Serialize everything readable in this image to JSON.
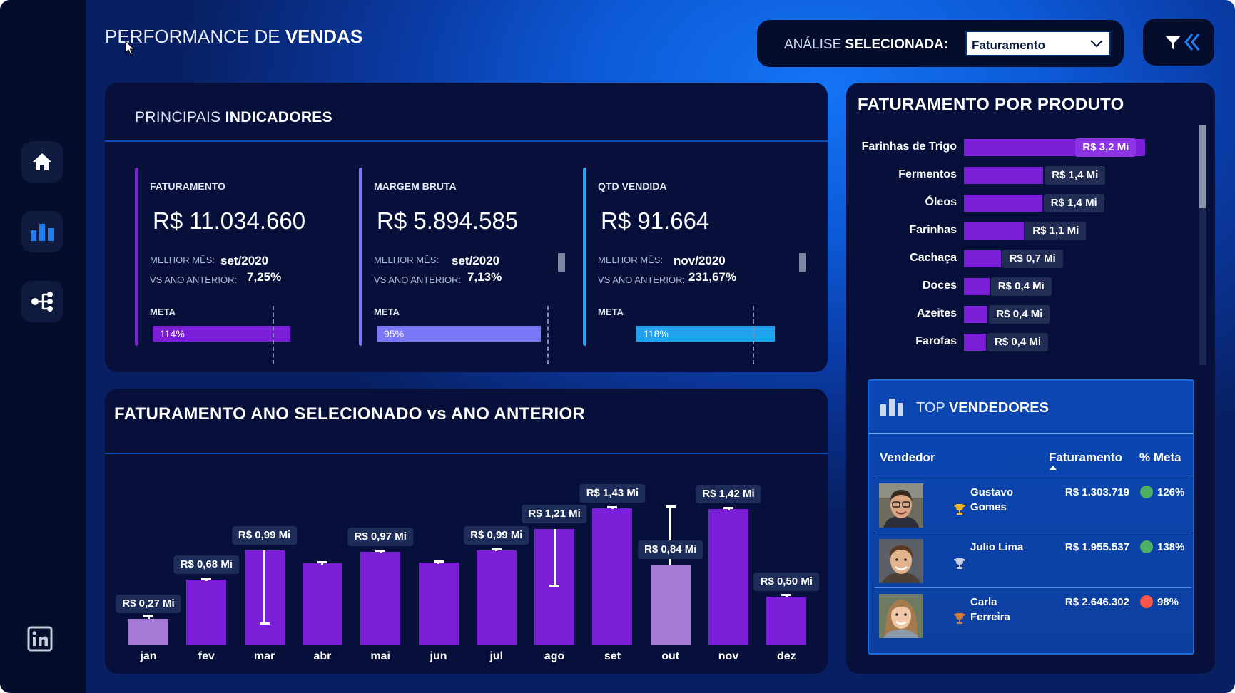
{
  "header": {
    "title_light": "PERFORMANCE DE ",
    "title_bold": "VENDAS",
    "analysis_label_light": "ANÁLISE ",
    "analysis_label_bold": "SELECIONADA:",
    "analysis_selected": "Faturamento"
  },
  "sidebar": {
    "items": [
      {
        "icon": "home-icon"
      },
      {
        "icon": "bar-chart-icon"
      },
      {
        "icon": "decomposition-tree-icon"
      }
    ],
    "footer_icon": "linkedin-icon"
  },
  "indicators": {
    "title_light": "PRINCIPAIS ",
    "title_bold": "INDICADORES",
    "best_month_label": "MELHOR MÊS:",
    "vs_prev_label": "VS ANO ANTERIOR:",
    "meta_label": "META",
    "kpis": [
      {
        "label": "FATURAMENTO",
        "value": "R$ 11.034.660",
        "best_month": "set/2020",
        "vs_prev": "7,25%",
        "meta": 114,
        "meta_text": "114%",
        "color": "#7a1ed8"
      },
      {
        "label": "MARGEM BRUTA",
        "value": "R$ 5.894.585",
        "best_month": "set/2020",
        "vs_prev": "7,13%",
        "meta": 95,
        "meta_text": "95%",
        "color": "#7b78f7"
      },
      {
        "label": "QTD VENDIDA",
        "value": "R$ 91.664",
        "best_month": "nov/2020",
        "vs_prev": "231,67%",
        "meta": 118,
        "meta_text": "118%",
        "color": "#1fa3ef"
      }
    ]
  },
  "monthly": {
    "title": "FATURAMENTO ANO SELECIONADO vs ANO ANTERIOR"
  },
  "chart_data": {
    "type": "bar",
    "categories": [
      "jan",
      "fev",
      "mar",
      "abr",
      "mai",
      "jun",
      "jul",
      "ago",
      "set",
      "out",
      "nov",
      "dez"
    ],
    "values": [
      0.27,
      0.68,
      0.99,
      0.85,
      0.97,
      0.86,
      0.99,
      1.21,
      1.43,
      0.84,
      1.42,
      0.5
    ],
    "previous_year": [
      0.3,
      0.69,
      0.22,
      0.86,
      0.98,
      0.87,
      1.0,
      0.62,
      1.44,
      1.45,
      1.43,
      0.52
    ],
    "labels": [
      "R$ 0,27 Mi",
      "R$ 0,68 Mi",
      "R$ 0,99 Mi",
      "",
      "R$ 0,97 Mi",
      "",
      "R$ 0,99 Mi",
      "R$ 1,21 Mi",
      "R$ 1,43 Mi",
      "R$ 0,84 Mi",
      "R$ 1,42 Mi",
      "R$ 0,50 Mi"
    ],
    "below_previous": [
      true,
      false,
      false,
      false,
      false,
      false,
      false,
      false,
      false,
      true,
      false,
      false
    ],
    "colors": {
      "up": "#7a1ed8",
      "down": "#a779d6",
      "marker": "#ffffff"
    },
    "ylim": [
      0,
      1.6
    ]
  },
  "products": {
    "title": "FATURAMENTO  POR PRODUTO",
    "items": [
      {
        "name": "Farinhas de Trigo",
        "value": 3.2,
        "label": "R$ 3,2 Mi"
      },
      {
        "name": "Fermentos",
        "value": 1.4,
        "label": "R$ 1,4 Mi"
      },
      {
        "name": "Óleos",
        "value": 1.38,
        "label": "R$ 1,4 Mi"
      },
      {
        "name": "Farinhas",
        "value": 1.06,
        "label": "R$ 1,1 Mi"
      },
      {
        "name": "Cachaça",
        "value": 0.65,
        "label": "R$ 0,7 Mi"
      },
      {
        "name": "Doces",
        "value": 0.45,
        "label": "R$ 0,4 Mi"
      },
      {
        "name": "Azeites",
        "value": 0.42,
        "label": "R$ 0,4 Mi"
      },
      {
        "name": "Farofas",
        "value": 0.39,
        "label": "R$ 0,4 Mi"
      }
    ]
  },
  "top_sellers": {
    "title_light": "TOP ",
    "title_bold": "VENDEDORES",
    "columns": [
      "Vendedor",
      "Faturamento",
      "% Meta"
    ],
    "rows": [
      {
        "name_line1": "Gustavo",
        "name_line2": "Gomes",
        "faturamento": "R$ 1.303.719",
        "meta": "126%",
        "status": "#4caf64",
        "trophy": "#f0b323"
      },
      {
        "name_line1": "Julio Lima",
        "name_line2": "",
        "faturamento": "R$ 1.955.537",
        "meta": "138%",
        "status": "#4caf64",
        "trophy": "#c9d2e0"
      },
      {
        "name_line1": "Carla",
        "name_line2": "Ferreira",
        "faturamento": "R$ 2.646.302",
        "meta": "98%",
        "status": "#f4574a",
        "trophy": "#cd7a3a"
      }
    ]
  }
}
